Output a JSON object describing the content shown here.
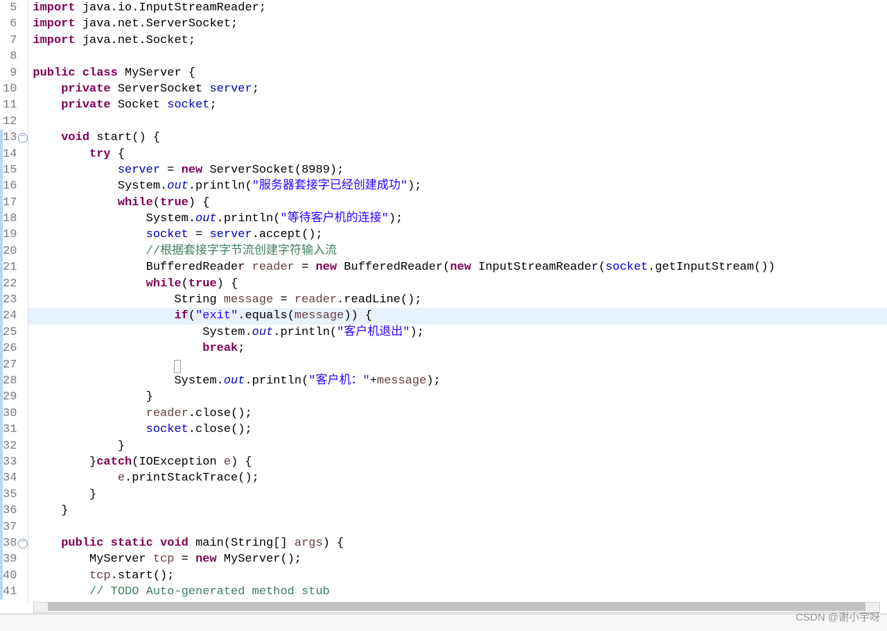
{
  "editor": {
    "visible_first_line": 5,
    "visible_last_line": 41,
    "highlighted_line": 24,
    "fold_markers": [
      13,
      38
    ],
    "quickdiff_changed_lines": [
      13,
      14,
      15,
      16,
      17,
      18,
      19,
      20,
      21,
      22,
      23,
      24,
      25,
      26,
      27,
      28,
      29,
      30,
      31,
      32,
      33,
      34,
      35,
      36,
      37,
      38,
      39,
      40,
      41
    ],
    "lines": {
      "5": [
        {
          "t": "import",
          "c": "kw"
        },
        {
          "t": " java.io.InputStreamReader;"
        }
      ],
      "6": [
        {
          "t": "import",
          "c": "kw"
        },
        {
          "t": " java.net.ServerSocket;"
        }
      ],
      "7": [
        {
          "t": "import",
          "c": "kw"
        },
        {
          "t": " java.net.Socket;"
        }
      ],
      "8": [],
      "9": [
        {
          "t": "public",
          "c": "kw"
        },
        {
          "t": " "
        },
        {
          "t": "class",
          "c": "kw"
        },
        {
          "t": " MyServer {"
        }
      ],
      "10": [
        {
          "t": "    "
        },
        {
          "t": "private",
          "c": "kw"
        },
        {
          "t": " ServerSocket "
        },
        {
          "t": "server",
          "c": "fld"
        },
        {
          "t": ";"
        }
      ],
      "11": [
        {
          "t": "    "
        },
        {
          "t": "private",
          "c": "kw"
        },
        {
          "t": " Socket "
        },
        {
          "t": "socket",
          "c": "fld"
        },
        {
          "t": ";"
        }
      ],
      "12": [],
      "13": [
        {
          "t": "    "
        },
        {
          "t": "void",
          "c": "kw"
        },
        {
          "t": " start() {"
        }
      ],
      "14": [
        {
          "t": "        "
        },
        {
          "t": "try",
          "c": "kw"
        },
        {
          "t": " {"
        }
      ],
      "15": [
        {
          "t": "            "
        },
        {
          "t": "server",
          "c": "fld"
        },
        {
          "t": " = "
        },
        {
          "t": "new",
          "c": "kw"
        },
        {
          "t": " ServerSocket(8989);"
        }
      ],
      "16": [
        {
          "t": "            System."
        },
        {
          "t": "out",
          "c": "sfld"
        },
        {
          "t": ".println("
        },
        {
          "t": "\"服务器套接字已经创建成功\"",
          "c": "str"
        },
        {
          "t": ");"
        }
      ],
      "17": [
        {
          "t": "            "
        },
        {
          "t": "while",
          "c": "kw"
        },
        {
          "t": "("
        },
        {
          "t": "true",
          "c": "kw"
        },
        {
          "t": ") {"
        }
      ],
      "18": [
        {
          "t": "                System."
        },
        {
          "t": "out",
          "c": "sfld"
        },
        {
          "t": ".println("
        },
        {
          "t": "\"等待客户机的连接\"",
          "c": "str"
        },
        {
          "t": ");"
        }
      ],
      "19": [
        {
          "t": "                "
        },
        {
          "t": "socket",
          "c": "fld"
        },
        {
          "t": " = "
        },
        {
          "t": "server",
          "c": "fld"
        },
        {
          "t": ".accept();"
        }
      ],
      "20": [
        {
          "t": "                "
        },
        {
          "t": "//根据套接字字节流创建字符输入流",
          "c": "cm"
        }
      ],
      "21": [
        {
          "t": "                BufferedReader "
        },
        {
          "t": "reader",
          "c": "var"
        },
        {
          "t": " = "
        },
        {
          "t": "new",
          "c": "kw"
        },
        {
          "t": " BufferedReader("
        },
        {
          "t": "new",
          "c": "kw"
        },
        {
          "t": " InputStreamReader("
        },
        {
          "t": "socket",
          "c": "fld"
        },
        {
          "t": ".getInputStream())"
        }
      ],
      "22": [
        {
          "t": "                "
        },
        {
          "t": "while",
          "c": "kw"
        },
        {
          "t": "("
        },
        {
          "t": "true",
          "c": "kw"
        },
        {
          "t": ") {"
        }
      ],
      "23": [
        {
          "t": "                    String "
        },
        {
          "t": "message",
          "c": "var"
        },
        {
          "t": " = "
        },
        {
          "t": "reader",
          "c": "var"
        },
        {
          "t": ".readLine();"
        }
      ],
      "24": [
        {
          "t": "                    "
        },
        {
          "t": "if",
          "c": "kw"
        },
        {
          "t": "("
        },
        {
          "t": "\"exit\"",
          "c": "str"
        },
        {
          "t": ".equals("
        },
        {
          "t": "message",
          "c": "var"
        },
        {
          "t": ")) {"
        }
      ],
      "25": [
        {
          "t": "                        System."
        },
        {
          "t": "out",
          "c": "sfld"
        },
        {
          "t": ".println("
        },
        {
          "t": "\"客户机退出\"",
          "c": "str"
        },
        {
          "t": ");"
        }
      ],
      "26": [
        {
          "t": "                        "
        },
        {
          "t": "break",
          "c": "kw"
        },
        {
          "t": ";"
        }
      ],
      "27": [
        {
          "t": "                    "
        },
        {
          "box": true
        }
      ],
      "28": [
        {
          "t": "                    System."
        },
        {
          "t": "out",
          "c": "sfld"
        },
        {
          "t": ".println("
        },
        {
          "t": "\"客户机：\"",
          "c": "str"
        },
        {
          "t": "+"
        },
        {
          "t": "message",
          "c": "var"
        },
        {
          "t": ");"
        }
      ],
      "29": [
        {
          "t": "                }"
        }
      ],
      "30": [
        {
          "t": "                "
        },
        {
          "t": "reader",
          "c": "var"
        },
        {
          "t": ".close();"
        }
      ],
      "31": [
        {
          "t": "                "
        },
        {
          "t": "socket",
          "c": "fld"
        },
        {
          "t": ".close();"
        }
      ],
      "32": [
        {
          "t": "            }"
        }
      ],
      "33": [
        {
          "t": "        }"
        },
        {
          "t": "catch",
          "c": "kw"
        },
        {
          "t": "(IOException "
        },
        {
          "t": "e",
          "c": "var"
        },
        {
          "t": ") {"
        }
      ],
      "34": [
        {
          "t": "            "
        },
        {
          "t": "e",
          "c": "var"
        },
        {
          "t": ".printStackTrace();"
        }
      ],
      "35": [
        {
          "t": "        }"
        }
      ],
      "36": [
        {
          "t": "    }"
        }
      ],
      "37": [],
      "38": [
        {
          "t": "    "
        },
        {
          "t": "public",
          "c": "kw"
        },
        {
          "t": " "
        },
        {
          "t": "static",
          "c": "kw"
        },
        {
          "t": " "
        },
        {
          "t": "void",
          "c": "kw"
        },
        {
          "t": " main(String[] "
        },
        {
          "t": "args",
          "c": "var"
        },
        {
          "t": ") {"
        }
      ],
      "39": [
        {
          "t": "        MyServer "
        },
        {
          "t": "tcp",
          "c": "var"
        },
        {
          "t": " = "
        },
        {
          "t": "new",
          "c": "kw"
        },
        {
          "t": " MyServer();"
        }
      ],
      "40": [
        {
          "t": "        "
        },
        {
          "t": "tcp",
          "c": "var"
        },
        {
          "t": ".start();"
        }
      ],
      "41": [
        {
          "t": "        "
        },
        {
          "t": "// TODO Auto-generated method stub",
          "c": "cm"
        }
      ]
    }
  },
  "watermark": "CSDN @谢小宇呀"
}
